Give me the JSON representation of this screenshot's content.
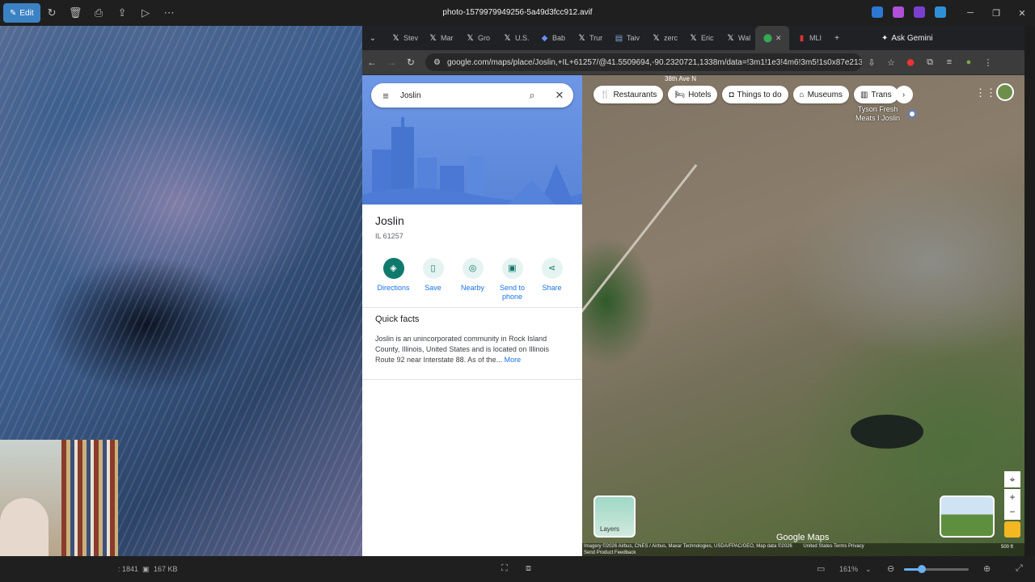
{
  "photo_viewer": {
    "edit_label": "Edit",
    "filename": "photo-1579979949256-5a49d3fcc912.avif",
    "status_dimensions": ": 1841",
    "status_size": "167 KB",
    "zoom": "161%",
    "zoom_fraction": 0.28
  },
  "browser": {
    "tabs": [
      {
        "icon": "x-logo-icon",
        "label": "Stev"
      },
      {
        "icon": "x-logo-icon",
        "label": "Mar"
      },
      {
        "icon": "x-logo-icon",
        "label": "Gro"
      },
      {
        "icon": "x-logo-icon",
        "label": "U.S."
      },
      {
        "icon": "babbel-icon",
        "label": "Bab"
      },
      {
        "icon": "x-logo-icon",
        "label": "Trur"
      },
      {
        "icon": "news-icon",
        "label": "Taiv"
      },
      {
        "icon": "x-logo-icon",
        "label": "zerc"
      },
      {
        "icon": "x-logo-icon",
        "label": "Eric"
      },
      {
        "icon": "x-logo-icon",
        "label": "Wal"
      }
    ],
    "active_tab": "maps-icon",
    "last_tab": "MLI",
    "gemini_label": "Ask Gemini",
    "url": "google.com/maps/place/Joslin,+IL+61257/@41.5509694,-90.2320721,1338m/data=!3m1!1e3!4m6!3m5!1s0x87e21381201bd..."
  },
  "maps": {
    "search_value": "Joslin",
    "place_title": "Joslin",
    "place_subtitle": "IL 61257",
    "actions": [
      {
        "label": "Directions",
        "icon": "directions-icon"
      },
      {
        "label": "Save",
        "icon": "bookmark-icon"
      },
      {
        "label": "Nearby",
        "icon": "nearby-icon"
      },
      {
        "label": "Send to phone",
        "icon": "send-to-phone-icon"
      },
      {
        "label": "Share",
        "icon": "share-icon"
      }
    ],
    "quick_facts_title": "Quick facts",
    "quick_facts_text": "Joslin is an unincorporated community in Rock Island County, Illinois, United States and is located on Illinois Route 92 near Interstate 88. As of the...",
    "quick_facts_more": "More",
    "chips": [
      "Restaurants",
      "Hotels",
      "Things to do",
      "Museums",
      "Trans"
    ],
    "road_label": "38th Ave N",
    "poi_label_line1": "Tyson Fresh",
    "poi_label_line2": "Meats I Joslin",
    "layers_label": "Layers",
    "logo": "Google Maps",
    "attribution": "Imagery ©2026 Airbus, CNES / Airbus, Maxar Technologies, USDA/FPAC/GEO, Map data ©2026",
    "attribution_links": "United States   Terms   Privacy",
    "feedback": "Send Product Feedback",
    "scale": "500 ft"
  }
}
